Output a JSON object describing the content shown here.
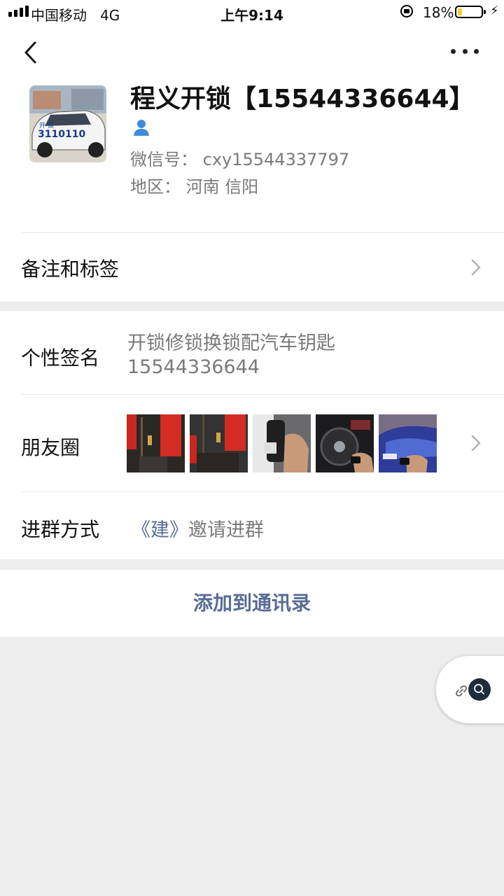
{
  "status_bar": {
    "carrier": "中国移动",
    "network": "4G",
    "time": "上午9:14",
    "battery_percent": "18%",
    "battery_level": 0.18
  },
  "profile": {
    "name": "程义开锁【15544336644】",
    "wechat_id": "微信号：  cxy15544337797",
    "region": "地区：  河南 信阳",
    "avatar_text_top": "开        锁",
    "avatar_text_main": "3110110"
  },
  "rows": {
    "remark_label": "备注和标签",
    "signature_label": "个性签名",
    "signature_value_line1": "开锁修锁换锁配汽车钥匙",
    "signature_value_line2": "15544336644",
    "moments_label": "朋友圈",
    "join_label": "进群方式",
    "join_link": "《建》",
    "join_text": "邀请进群"
  },
  "actions": {
    "add_contact": "添加到通讯录"
  },
  "moments_thumbs": [
    "door-banner-photo",
    "door-banner-photo",
    "key-in-hand-photo",
    "steering-wheel-photo",
    "blue-car-key-photo"
  ],
  "colors": {
    "link": "#576b95",
    "secondary_text": "#7a7a7a",
    "background": "#ededed"
  }
}
